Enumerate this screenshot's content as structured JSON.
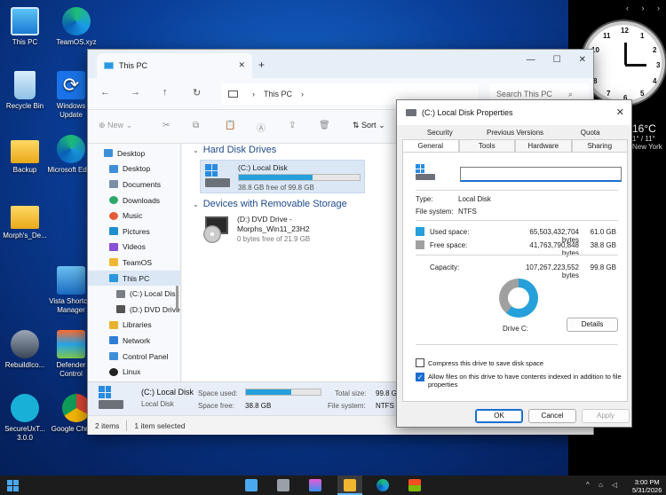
{
  "desktop": {
    "icons": [
      {
        "label": "This PC"
      },
      {
        "label": "TeamOS.xyz"
      },
      {
        "label": "Recycle Bin"
      },
      {
        "label": "Windows Update"
      },
      {
        "label": "Backup"
      },
      {
        "label": "Microsoft Edge"
      },
      {
        "label": "Morph's_De..."
      },
      {
        "label": "Vista Shortcut Manager"
      },
      {
        "label": "RebuildIco..."
      },
      {
        "label": "Defender Control"
      },
      {
        "label": "SecureUxT... 3.0.0"
      },
      {
        "label": "Google Chrome"
      }
    ],
    "weather": {
      "temp": "16°C",
      "line1": "1° / 11°",
      "line2": "New York"
    }
  },
  "clock": {
    "numbers": [
      "12",
      "1",
      "2",
      "3",
      "4",
      "5",
      "6",
      "7",
      "8",
      "9",
      "10",
      "11"
    ]
  },
  "explorer": {
    "tab_title": "This PC",
    "breadcrumb": "This PC",
    "search_placeholder": "Search This PC",
    "toolbar": {
      "new_label": "New",
      "sort_label": "Sort"
    },
    "nav": [
      {
        "label": "Desktop",
        "level": "top"
      },
      {
        "label": "Desktop",
        "level": "child"
      },
      {
        "label": "Documents",
        "level": "child"
      },
      {
        "label": "Downloads",
        "level": "child"
      },
      {
        "label": "Music",
        "level": "child"
      },
      {
        "label": "Pictures",
        "level": "child"
      },
      {
        "label": "Videos",
        "level": "child"
      },
      {
        "label": "TeamOS",
        "level": "child"
      },
      {
        "label": "This PC",
        "level": "child"
      },
      {
        "label": "(C:) Local Disk",
        "level": "sub"
      },
      {
        "label": "(D:) DVD Drive",
        "level": "sub"
      },
      {
        "label": "Libraries",
        "level": "child"
      },
      {
        "label": "Network",
        "level": "child"
      },
      {
        "label": "Control Panel",
        "level": "child"
      },
      {
        "label": "Linux",
        "level": "child"
      }
    ],
    "groups": {
      "hdd_title": "Hard Disk Drives",
      "removable_title": "Devices with Removable Storage"
    },
    "drive_c": {
      "name": "(C:) Local Disk",
      "free_text": "38.8 GB free of 99.8 GB",
      "used_fraction": 0.61
    },
    "drive_d": {
      "name_line1": "(D:) DVD Drive -",
      "name_line2": "Morphs_Win11_23H2",
      "free_text": "0 bytes free of 21.9 GB"
    },
    "details": {
      "name": "(C:) Local Disk",
      "type": "Local Disk",
      "space_used_label": "Space used:",
      "space_free_label": "Space free:",
      "space_free": "38.8 GB",
      "total_size_label": "Total size:",
      "total_size": "99.8 G",
      "file_system_label": "File system:",
      "file_system": "NTFS",
      "used_fraction": 0.61
    },
    "status": {
      "items": "2 items",
      "selected": "1 item selected"
    }
  },
  "props": {
    "title": "(C:) Local Disk Properties",
    "tabs_back": [
      "Security",
      "Previous Versions",
      "Quota"
    ],
    "tabs_front": [
      "General",
      "Tools",
      "Hardware",
      "Sharing"
    ],
    "type_label": "Type:",
    "type_value": "Local Disk",
    "fs_label": "File system:",
    "fs_value": "NTFS",
    "used_label": "Used space:",
    "used_bytes": "65,503,432,704 bytes",
    "used_gb": "61.0 GB",
    "free_label": "Free space:",
    "free_bytes": "41,763,790,848 bytes",
    "free_gb": "38.8 GB",
    "capacity_label": "Capacity:",
    "capacity_bytes": "107,267,223,552 bytes",
    "capacity_gb": "99.8 GB",
    "used_fraction": 0.61,
    "drive_label": "Drive C:",
    "details_btn": "Details",
    "compress_label": "Compress this drive to save disk space",
    "index_label": "Allow files on this drive to have contents indexed in addition to file properties",
    "ok": "OK",
    "cancel": "Cancel",
    "apply": "Apply",
    "colors": {
      "used": "#26a0da",
      "free": "#a0a0a0"
    }
  },
  "taskbar": {
    "time": "3:00 PM",
    "date": "5/31/2026"
  }
}
